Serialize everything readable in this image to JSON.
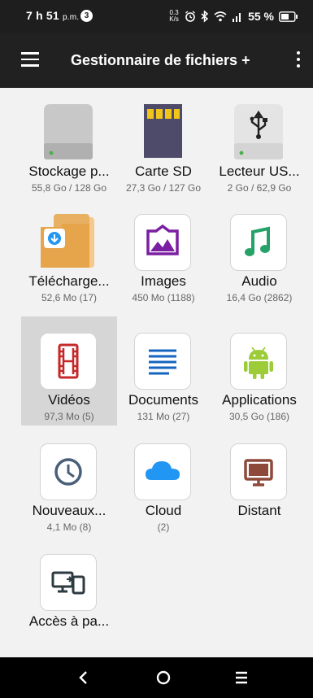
{
  "status_bar": {
    "time": "7 h 51",
    "time_suffix": "p.m.",
    "notification_count": "3",
    "speed": "0.3 K/s",
    "battery": "55 %"
  },
  "toolbar": {
    "title": "Gestionnaire de fichiers +"
  },
  "items": [
    {
      "label": "Stockage p...",
      "sub": "55,8 Go / 128 Go",
      "icon": "hard-drive-icon"
    },
    {
      "label": "Carte SD",
      "sub": "27,3 Go / 127 Go",
      "icon": "sd-card-icon"
    },
    {
      "label": "Lecteur US...",
      "sub": "2 Go / 62,9 Go",
      "icon": "usb-drive-icon"
    },
    {
      "label": "Télécharge...",
      "sub": "52,6 Mo (17)",
      "icon": "downloads-folder-icon"
    },
    {
      "label": "Images",
      "sub": "450 Mo (1188)",
      "icon": "image-icon"
    },
    {
      "label": "Audio",
      "sub": "16,4 Go (2862)",
      "icon": "music-note-icon"
    },
    {
      "label": "Vidéos",
      "sub": "97,3 Mo (5)",
      "icon": "film-icon"
    },
    {
      "label": "Documents",
      "sub": "131 Mo (27)",
      "icon": "document-lines-icon"
    },
    {
      "label": "Applications",
      "sub": "30,5 Go (186)",
      "icon": "android-icon"
    },
    {
      "label": "Nouveaux...",
      "sub": "4,1 Mo (8)",
      "icon": "clock-icon"
    },
    {
      "label": "Cloud",
      "sub": "(2)",
      "icon": "cloud-icon"
    },
    {
      "label": "Distant",
      "sub": "",
      "icon": "monitor-icon"
    },
    {
      "label": "Accès à pa...",
      "sub": "",
      "icon": "devices-icon"
    }
  ],
  "selected_item": "Vidéos",
  "colors": {
    "toolbar_bg": "#212121",
    "background": "#f2f2f2",
    "selected_bg": "#d6d6d6",
    "images_purple": "#7b1fa2",
    "audio_green": "#26a269",
    "videos_red": "#c62828",
    "documents_blue": "#1565c0",
    "android_green": "#9ccc38",
    "cloud_blue": "#2196f3",
    "distant_brown": "#8d4a3a",
    "folder_orange": "#e6a54a"
  }
}
